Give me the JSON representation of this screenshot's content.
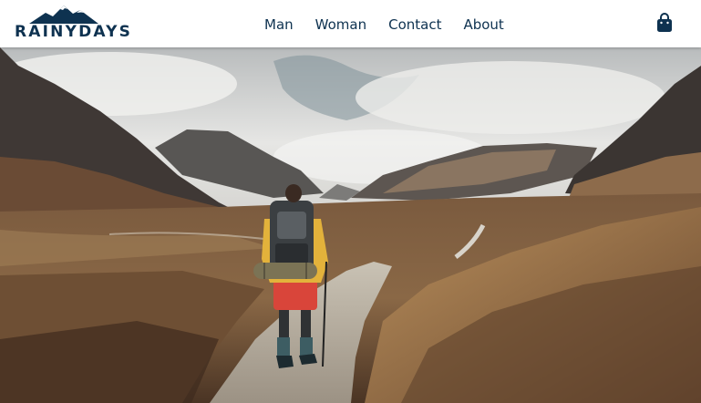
{
  "brand": {
    "name": "RAINYDAYS",
    "logo_icon": "mountain-logo-icon",
    "color": "#0e3250"
  },
  "nav": {
    "items": [
      {
        "label": "Man"
      },
      {
        "label": "Woman"
      },
      {
        "label": "Contact"
      },
      {
        "label": "About"
      }
    ]
  },
  "cart": {
    "icon": "shopping-bag-icon"
  },
  "hero": {
    "image": "hiker-on-mountain-trail-photo"
  }
}
